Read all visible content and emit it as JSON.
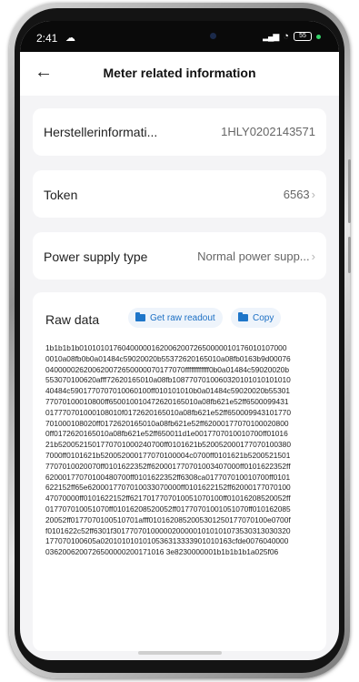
{
  "status_bar": {
    "time": "2:41",
    "battery": "55"
  },
  "header": {
    "title": "Meter related information"
  },
  "rows": [
    {
      "label": "Herstellerinformati...",
      "value": "1HLY0202143571"
    },
    {
      "label": "Token",
      "value": "6563"
    },
    {
      "label": "Power supply type",
      "value": "Normal power supp..."
    }
  ],
  "raw": {
    "title": "Raw data",
    "get_button": "Get raw readout",
    "copy_button": "Copy",
    "text": "1b1b1b1b01010101760400000162006200726500000101760101070000010a08fb0b0a01484c59020020b55372620165010a08fb0163b9d00076040000026200620072650000070177070ffffffffffff0b0a01484c59020020b553070100620afff72620165010a08fb108770701006032010101010101040484c5901770707010060100ff010101010b0a01484c59020020b5530177070100010800ff650010010472620165010a08fb621e52ff6500099431017770701000108010f0172620165010a08fb621e52ff650009943101770701000108020ff0172620165010a08fb621e52ff620001770701000208000ff0172620165010a08fb621e52ff650011d1e0017707010010700ff0101621b5200521501770701000240700ff0101621b5200520001770701003807000ff0101621b520052000177070100004c0700ff0101621b52005215017707010020070ff0101622352ff620001770701003407000ff0101622352ff62000177070100480700ff0101622352ff6308ca017707010010700ff0101622152ff65e6200017707010033070000ff0101622152ff6200017707010047070000ff0101622152ff6217017707010051070100ff01016208520052ff017707010051070ff01016208520052ff01770701001051070ff01016208520052ff0177070100510701afff0101620852005301250177070100e0700ff0101622c52ff6301f301770701000002000001010101073530313030320177070100605a0201010101010536313333901010163cfde00760400000362006200726500000200171016 3e8230000001b1b1b1b1a025f06"
  }
}
